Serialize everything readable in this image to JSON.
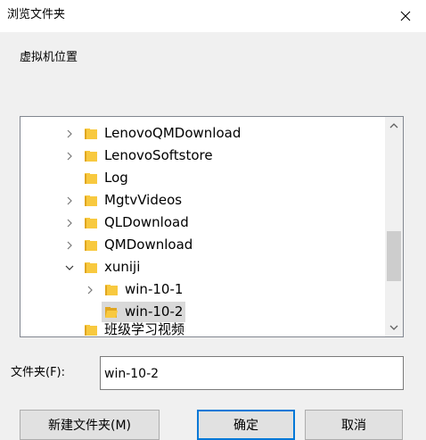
{
  "window": {
    "title": "浏览文件夹"
  },
  "description": "虚拟机位置",
  "tree": {
    "items": [
      {
        "label": "LenovoQMDownload",
        "expander": "chevron-right",
        "selected": false
      },
      {
        "label": "LenovoSoftstore",
        "expander": "chevron-right",
        "selected": false
      },
      {
        "label": "Log",
        "expander": "none",
        "selected": false
      },
      {
        "label": "MgtvVideos",
        "expander": "chevron-right",
        "selected": false
      },
      {
        "label": "QLDownload",
        "expander": "chevron-right",
        "selected": false
      },
      {
        "label": "QMDownload",
        "expander": "chevron-right",
        "selected": false
      },
      {
        "label": "xuniji",
        "expander": "chevron-down",
        "selected": false
      },
      {
        "label": "win-10-1",
        "expander": "chevron-right",
        "selected": false
      },
      {
        "label": "win-10-2",
        "expander": "none",
        "selected": true
      },
      {
        "label": "班级学习视频",
        "expander": "none",
        "selected": false
      }
    ]
  },
  "folder_field": {
    "label": "文件夹(F):",
    "value": "win-10-2"
  },
  "buttons": {
    "new_folder": "新建文件夹(M)",
    "ok": "确定",
    "cancel": "取消"
  },
  "colors": {
    "folder": "#f8c93f",
    "selection": "#d9d9d9",
    "default_button_border": "#0078d7"
  }
}
